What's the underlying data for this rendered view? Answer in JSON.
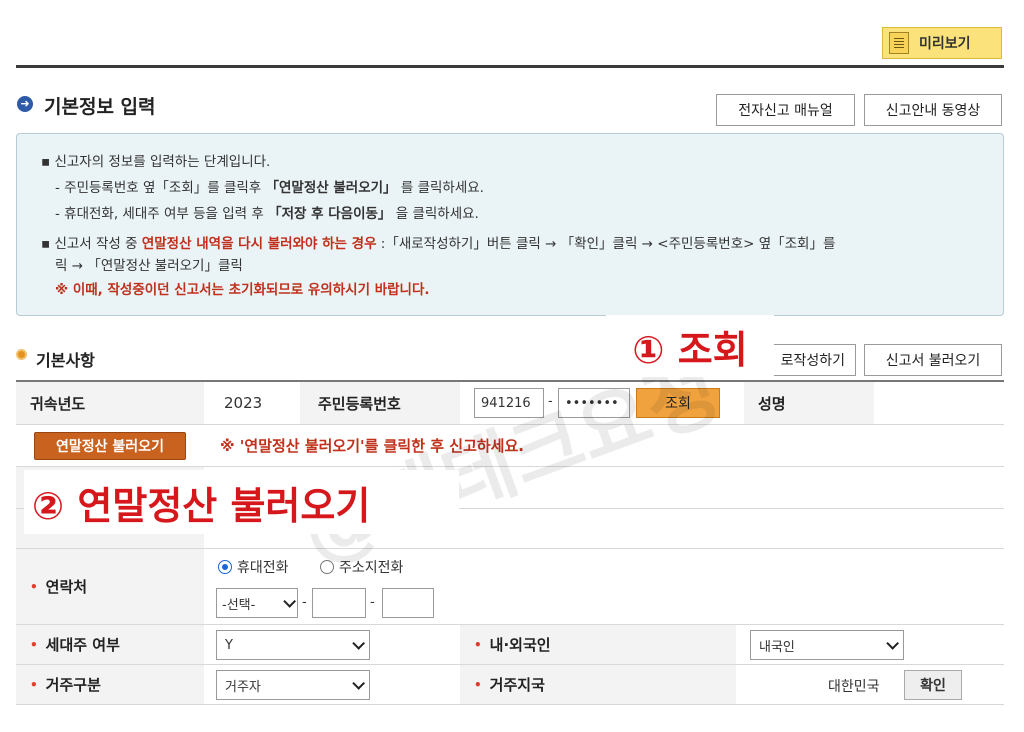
{
  "toolbar": {
    "preview_label": "미리보기"
  },
  "section": {
    "title": "기본정보 입력",
    "manual_label": "전자신고 매뉴얼",
    "video_label": "신고안내 동영상"
  },
  "info": {
    "line1": "▪ 신고자의 정보를 입력하는 단계입니다.",
    "line2_pre": "- 주민등록번호 옆「조회」를 클릭후 ",
    "line2_bold": "「연말정산 불러오기」",
    "line2_post": " 를 클릭하세요.",
    "line3_pre": "- 휴대전화, 세대주 여부 등을 입력 후 ",
    "line3_bold": "「저장 후 다음이동」",
    "line3_post": " 을 클릭하세요.",
    "line4_pre": "▪ 신고서 작성 중 ",
    "line4_red": "연말정산 내역을 다시 불러와야 하는 경우",
    "line4_post": " :「새로작성하기」버튼 클릭 → 「확인」클릭 → <주민등록번호> 옆「조회」를",
    "line5": "릭 → 「연말정산 불러오기」클릭",
    "line6": "※ 이때, 작성중이던 신고서는 초기화되므로 유의하시기 바랍니다."
  },
  "annotations": {
    "step1": "① 조회",
    "step2": "② 연말정산 불러오기"
  },
  "basics": {
    "title": "기본사항",
    "new_write_label": "로작성하기",
    "load_report_label": "신고서 불러오기"
  },
  "table": {
    "year_label": "귀속년도",
    "year_value": "2023",
    "rrn_label": "주민등록번호",
    "rrn_front": "941216",
    "rrn_sep": "-",
    "rrn_back": "•••••••",
    "lookup_label": "조회",
    "name_label": "성명",
    "yearend_button": "연말정산 불러오기",
    "yearend_notice": "※ '연말정산 불러오기'를 클릭한 후 신고하세요.",
    "contact_label": "연락처",
    "radio_mobile": "휴대전화",
    "radio_home": "주소지전화",
    "select_placeholder": "-선택-",
    "phone_sep": "-",
    "householder_label": "세대주 여부",
    "householder_value": "Y",
    "nationality_label": "내·외국인",
    "nationality_value": "내국인",
    "residence_label": "거주구분",
    "residence_value": "거주자",
    "residence_country_label": "거주지국",
    "residence_country_value": "대한민국",
    "confirm_label": "확인",
    "required_mark": "•"
  },
  "watermark": "@재테크요정"
}
